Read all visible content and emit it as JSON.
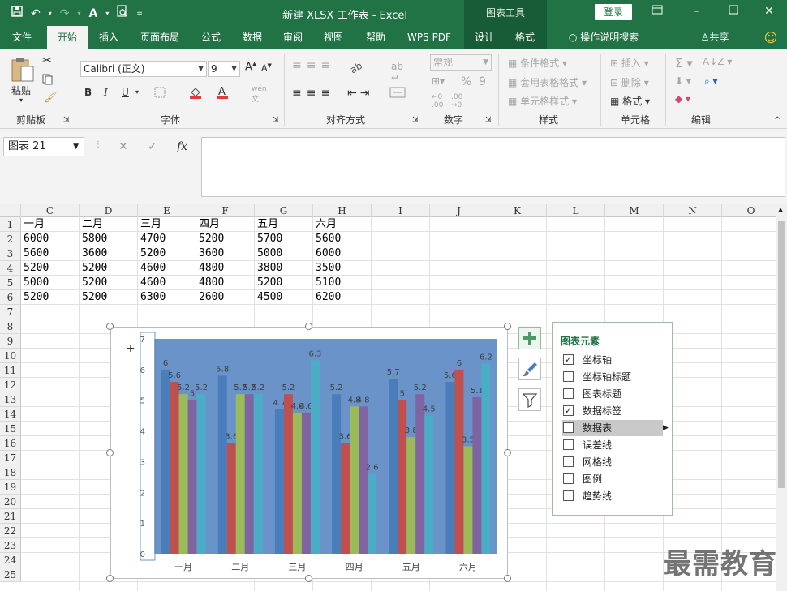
{
  "titlebar": {
    "title": "新建 XLSX 工作表 - Excel",
    "chart_tools": "图表工具",
    "login": "登录"
  },
  "tabs": [
    "文件",
    "开始",
    "插入",
    "页面布局",
    "公式",
    "数据",
    "审阅",
    "视图",
    "帮助",
    "WPS PDF",
    "设计",
    "格式",
    "操作说明搜索",
    "共享"
  ],
  "active_tab": "开始",
  "ribbon": {
    "clipboard": {
      "paste": "粘贴",
      "label": "剪贴板"
    },
    "font": {
      "name": "Calibri (正文)",
      "size": "9",
      "label": "字体",
      "bold": "B",
      "italic": "I",
      "underline": "U"
    },
    "align": {
      "label": "对齐方式"
    },
    "number": {
      "format": "常规",
      "label": "数字",
      "percent": "%",
      "comma": "9"
    },
    "styles": {
      "cond": "条件格式",
      "table": "套用表格格式",
      "cell": "单元格样式",
      "label": "样式"
    },
    "cells": {
      "insert": "插入",
      "delete": "删除",
      "format": "格式",
      "label": "单元格"
    },
    "editing": {
      "label": "编辑"
    }
  },
  "formula_bar": {
    "name_box": "图表 21",
    "formula": ""
  },
  "columns": [
    "C",
    "D",
    "E",
    "F",
    "G",
    "H",
    "I",
    "J",
    "K",
    "L",
    "M",
    "N",
    "O"
  ],
  "rows": [
    "1",
    "2",
    "3",
    "4",
    "5",
    "6",
    "7",
    "8",
    "9",
    "10",
    "11",
    "12",
    "13",
    "14",
    "15",
    "16",
    "17",
    "18",
    "19",
    "20",
    "21",
    "22",
    "23",
    "24",
    "25"
  ],
  "sheet": {
    "headers": [
      "一月",
      "二月",
      "三月",
      "四月",
      "五月",
      "六月"
    ],
    "data": [
      [
        "6000",
        "5800",
        "4700",
        "5200",
        "5700",
        "5600"
      ],
      [
        "5600",
        "3600",
        "5200",
        "3600",
        "5000",
        "6000"
      ],
      [
        "5200",
        "5200",
        "4600",
        "4800",
        "3800",
        "3500"
      ],
      [
        "5000",
        "5200",
        "4600",
        "4800",
        "5200",
        "5100"
      ],
      [
        "5200",
        "5200",
        "6300",
        "2600",
        "4500",
        "6200"
      ]
    ]
  },
  "chart_data": {
    "type": "bar",
    "categories": [
      "一月",
      "二月",
      "三月",
      "四月",
      "五月",
      "六月"
    ],
    "series": [
      {
        "values": [
          6,
          5.8,
          4.7,
          5.2,
          5.7,
          5.6
        ],
        "color": "#4a7ebb"
      },
      {
        "values": [
          5.6,
          3.6,
          5.2,
          3.6,
          5,
          6
        ],
        "color": "#c0504d"
      },
      {
        "values": [
          5.2,
          5.2,
          4.6,
          4.8,
          3.8,
          3.5
        ],
        "color": "#9bbb59"
      },
      {
        "values": [
          5,
          5.2,
          4.6,
          4.8,
          5.2,
          5.1
        ],
        "color": "#8064a2"
      },
      {
        "values": [
          5.2,
          5.2,
          6.3,
          2.6,
          4.5,
          6.2
        ],
        "color": "#4bacc6"
      }
    ],
    "yticks": [
      "0",
      "1",
      "2",
      "3",
      "4",
      "5",
      "6",
      "7"
    ],
    "ylim": [
      0,
      7
    ],
    "plot_bg": "#6a93c9",
    "data_labels": true,
    "legend": false,
    "title": ""
  },
  "panel": {
    "title": "图表元素",
    "items": [
      {
        "label": "坐标轴",
        "checked": true
      },
      {
        "label": "坐标轴标题",
        "checked": false
      },
      {
        "label": "图表标题",
        "checked": false
      },
      {
        "label": "数据标签",
        "checked": true
      },
      {
        "label": "数据表",
        "checked": false,
        "highlight": true
      },
      {
        "label": "误差线",
        "checked": false
      },
      {
        "label": "网格线",
        "checked": false
      },
      {
        "label": "图例",
        "checked": false
      },
      {
        "label": "趋势线",
        "checked": false
      }
    ]
  },
  "watermark": "最需教育",
  "colors": {
    "excel_green": "#217346",
    "ribbon_bg": "#f3f3f3"
  }
}
